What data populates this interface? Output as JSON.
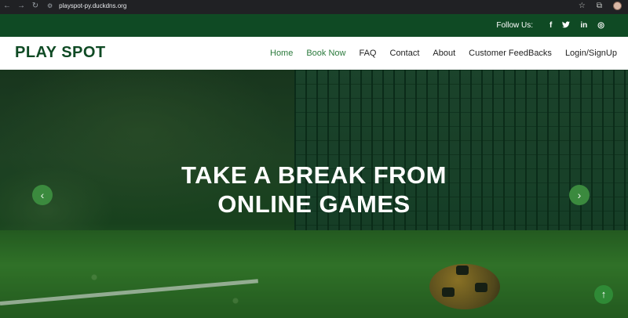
{
  "browser": {
    "url": "playspot-py.duckdns.org"
  },
  "topbar": {
    "follow_label": "Follow Us:",
    "social": [
      {
        "name": "facebook-icon",
        "glyph": "f"
      },
      {
        "name": "twitter-icon",
        "glyph": "t"
      },
      {
        "name": "linkedin-icon",
        "glyph": "in"
      },
      {
        "name": "instagram-icon",
        "glyph": "◎"
      }
    ]
  },
  "header": {
    "logo": "PLAY SPOT",
    "nav": [
      {
        "label": "Home",
        "active": true
      },
      {
        "label": "Book Now",
        "active": true
      },
      {
        "label": "FAQ",
        "active": false
      },
      {
        "label": "Contact",
        "active": false
      },
      {
        "label": "About",
        "active": false
      },
      {
        "label": "Customer FeedBacks",
        "active": false
      },
      {
        "label": "Login/SignUp",
        "active": false
      }
    ]
  },
  "hero": {
    "title_line1": "TAKE A BREAK FROM",
    "title_line2": "ONLINE GAMES"
  },
  "colors": {
    "brand_green": "#0f4a24",
    "active_link": "#2b7a3c",
    "arrow_green": "#3b8a3e"
  }
}
